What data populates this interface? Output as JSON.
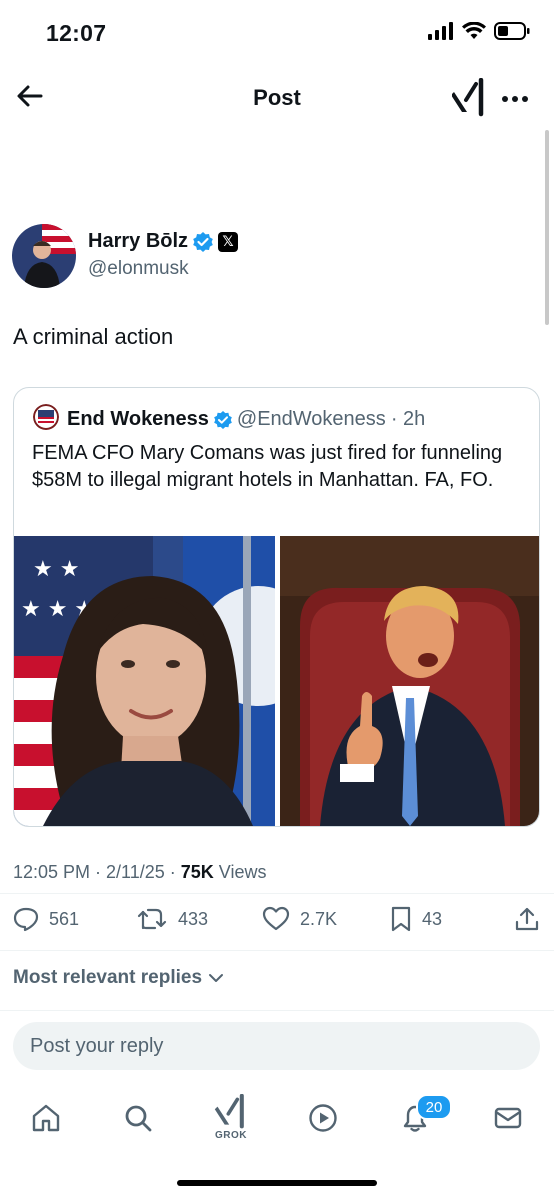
{
  "status_bar": {
    "time": "12:07"
  },
  "header": {
    "title": "Post"
  },
  "post": {
    "author_name": "Harry Bōlz",
    "author_handle": "@elonmusk",
    "text": "A criminal action",
    "timestamp": "12:05 PM · 2/11/25 · ",
    "views_count": "75K",
    "views_label": " Views"
  },
  "quote": {
    "name": "End Wokeness",
    "handle": "@EndWokeness",
    "time": "· 2h",
    "text": "FEMA CFO Mary Comans was just fired for funneling $58M to illegal migrant hotels in Manhattan. FA, FO."
  },
  "actions": {
    "replies": "561",
    "reposts": "433",
    "likes": "2.7K",
    "bookmarks": "43"
  },
  "replies_sort": "Most relevant replies",
  "reply_input": {
    "placeholder": "Post your reply"
  },
  "nav": {
    "grok_label": "GROK",
    "notifications_count": "20"
  },
  "colors": {
    "accent": "#1d9bf0",
    "secondary_text": "#536471"
  }
}
